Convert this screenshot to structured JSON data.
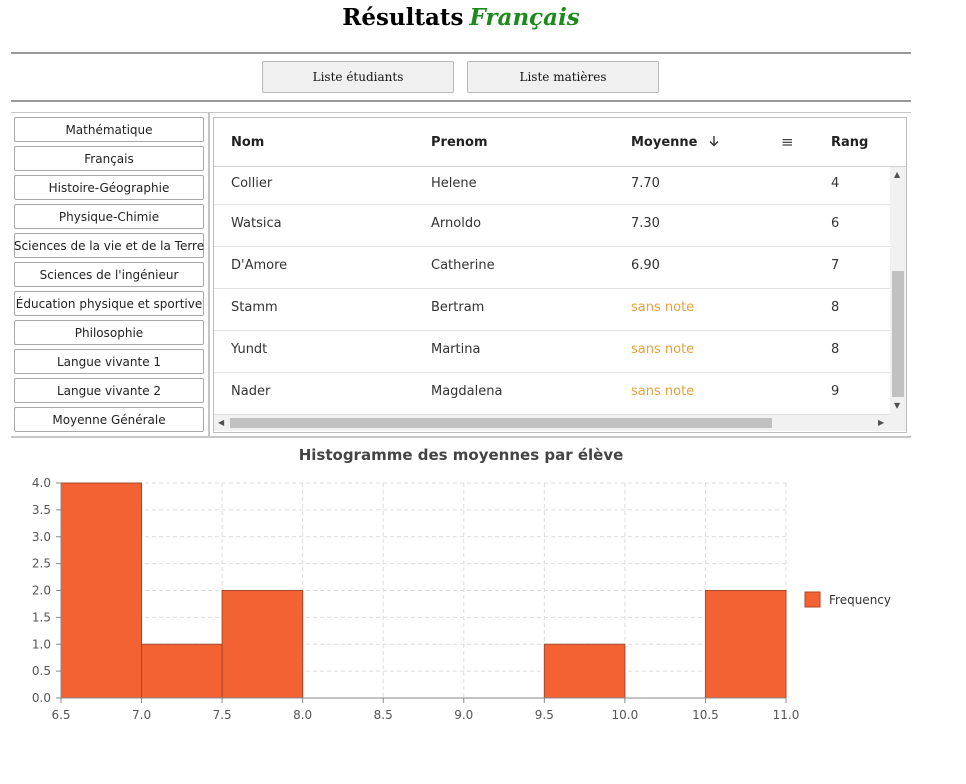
{
  "header": {
    "title_prefix": "Résultats",
    "subject": "Français"
  },
  "nav": {
    "students_label": "Liste étudiants",
    "subjects_label": "Liste matières"
  },
  "subjects": [
    "Mathématique",
    "Français",
    "Histoire-Géographie",
    "Physique-Chimie",
    "Sciences de la vie et de la Terre",
    "Sciences de l'ingénieur",
    "Éducation physique et sportive",
    "Philosophie",
    "Langue vivante 1",
    "Langue vivante 2",
    "Moyenne Générale"
  ],
  "table": {
    "columns": {
      "nom": "Nom",
      "prenom": "Prenom",
      "moyenne": "Moyenne",
      "rang": "Rang"
    },
    "sort_icon": "arrow-down-icon",
    "menu_icon": "hamburger-menu-icon",
    "rows": [
      {
        "nom": "Collier",
        "prenom": "Helene",
        "moyenne": "7.70",
        "rang": "4"
      },
      {
        "nom": "Watsica",
        "prenom": "Arnoldo",
        "moyenne": "7.30",
        "rang": "6"
      },
      {
        "nom": "D'Amore",
        "prenom": "Catherine",
        "moyenne": "6.90",
        "rang": "7"
      },
      {
        "nom": "Stamm",
        "prenom": "Bertram",
        "moyenne": "sans note",
        "rang": "8"
      },
      {
        "nom": "Yundt",
        "prenom": "Martina",
        "moyenne": "sans note",
        "rang": "8"
      },
      {
        "nom": "Nader",
        "prenom": "Magdalena",
        "moyenne": "sans note",
        "rang": "9"
      }
    ]
  },
  "colors": {
    "bar": "#f26232",
    "subject": "#1d8a1d",
    "no_note": "#e8a13a"
  },
  "chart_data": {
    "type": "bar",
    "title": "Histogramme des moyennes par élève",
    "xlabel": "",
    "ylabel": "",
    "bins": [
      {
        "from": 6.5,
        "to": 7.0,
        "count": 4
      },
      {
        "from": 7.0,
        "to": 7.5,
        "count": 1
      },
      {
        "from": 7.5,
        "to": 8.0,
        "count": 2
      },
      {
        "from": 9.5,
        "to": 10.0,
        "count": 1
      },
      {
        "from": 10.5,
        "to": 11.0,
        "count": 2
      }
    ],
    "xlim": [
      6.5,
      11.0
    ],
    "ylim": [
      0,
      4.0
    ],
    "x_ticks": [
      "6.5",
      "7.0",
      "7.5",
      "8.0",
      "8.5",
      "9.0",
      "9.5",
      "10.0",
      "10.5",
      "11.0"
    ],
    "y_ticks": [
      "0.0",
      "0.5",
      "1.0",
      "1.5",
      "2.0",
      "2.5",
      "3.0",
      "3.5",
      "4.0"
    ],
    "legend": "Frequency",
    "legend_position": "right",
    "grid": true
  }
}
